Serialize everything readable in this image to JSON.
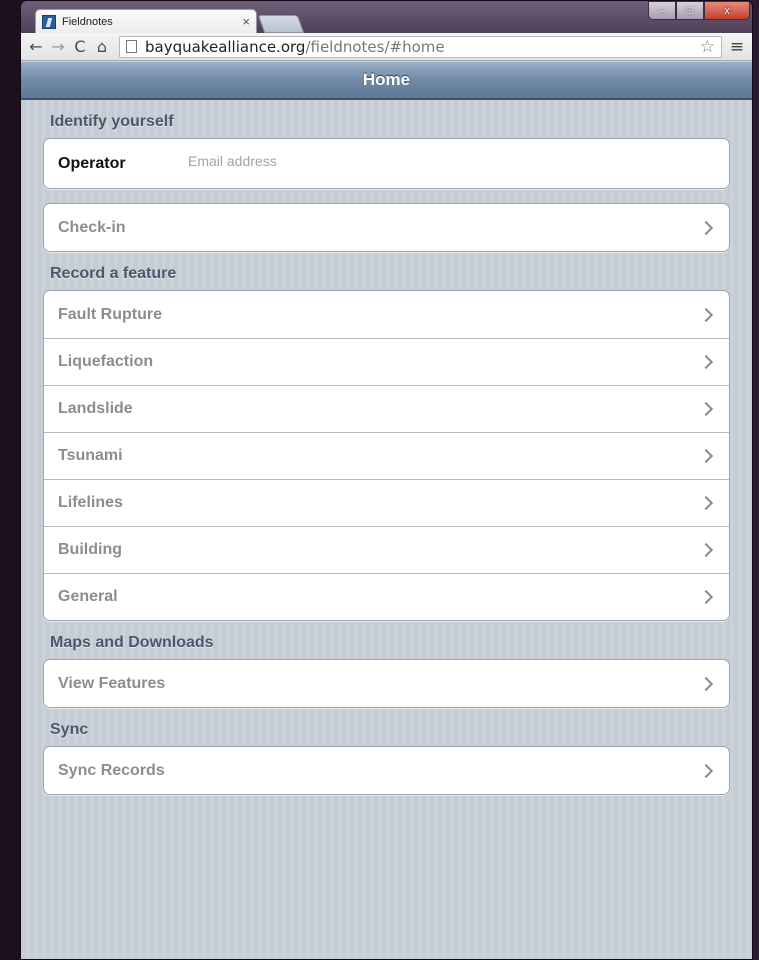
{
  "browser": {
    "tab_title": "Fieldnotes",
    "tab_close": "×",
    "url_host": "bayquakealliance.org",
    "url_path": "/fieldnotes/#home",
    "window_buttons": {
      "minimize": "–",
      "maximize": "□",
      "close": "x"
    }
  },
  "header": {
    "title": "Home"
  },
  "sections": {
    "identify": {
      "label": "Identify yourself",
      "operator_label": "Operator",
      "email_placeholder": "Email address",
      "checkin_label": "Check-in"
    },
    "record": {
      "label": "Record a feature",
      "items": [
        "Fault Rupture",
        "Liquefaction",
        "Landslide",
        "Tsunami",
        "Lifelines",
        "Building",
        "General"
      ]
    },
    "maps": {
      "label": "Maps and Downloads",
      "items": [
        "View Features"
      ]
    },
    "sync": {
      "label": "Sync",
      "items": [
        "Sync Records"
      ]
    }
  },
  "colors": {
    "header_blue": "#6f88a6",
    "background": "#c5ccd4",
    "section_text": "#4c566c"
  }
}
